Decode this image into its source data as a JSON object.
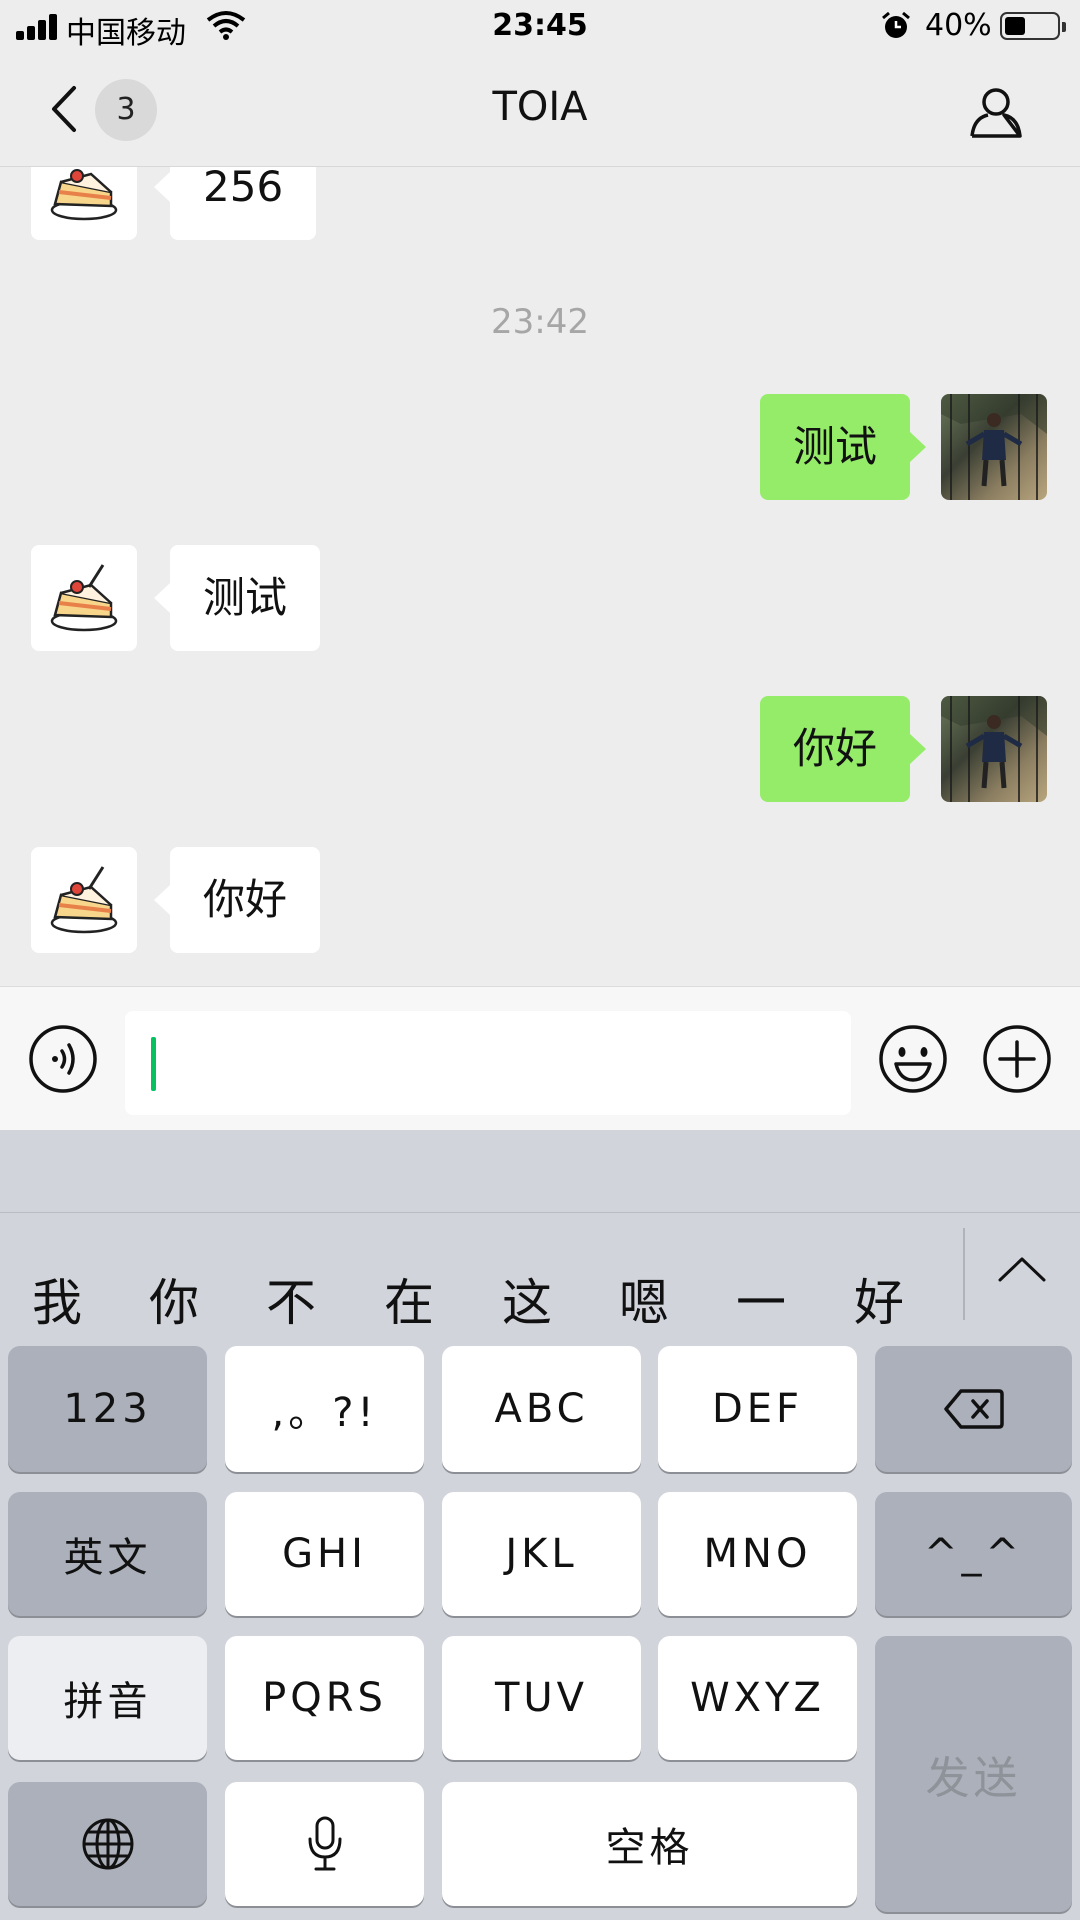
{
  "status_bar": {
    "carrier": "中国移动",
    "time": "23:45",
    "battery_percent": "40%",
    "battery_level": 0.4
  },
  "nav": {
    "unread_count": "3",
    "title": "TOIA"
  },
  "messages": {
    "partial_incoming": "256",
    "time_separator": "23:42",
    "items": [
      {
        "side": "out",
        "text": "测试"
      },
      {
        "side": "in",
        "text": "测试"
      },
      {
        "side": "out",
        "text": "你好"
      },
      {
        "side": "in",
        "text": "你好"
      }
    ]
  },
  "input": {
    "value": ""
  },
  "keyboard": {
    "candidates": [
      "我",
      "你",
      "不",
      "在",
      "这",
      "嗯",
      "一",
      "好"
    ],
    "keys": {
      "num": "123",
      "punct": ",。?!",
      "abc": "ABC",
      "def": "DEF",
      "english": "英文",
      "ghi": "GHI",
      "jkl": "JKL",
      "mno": "MNO",
      "emoticon": "^_^",
      "pinyin": "拼音",
      "pqrs": "PQRS",
      "tuv": "TUV",
      "wxyz": "WXYZ",
      "send": "发送",
      "space": "空格"
    }
  },
  "colors": {
    "outgoing_bubble": "#95ec69",
    "incoming_bubble": "#ffffff",
    "caret": "#07c160",
    "chat_background": "#ededed"
  }
}
